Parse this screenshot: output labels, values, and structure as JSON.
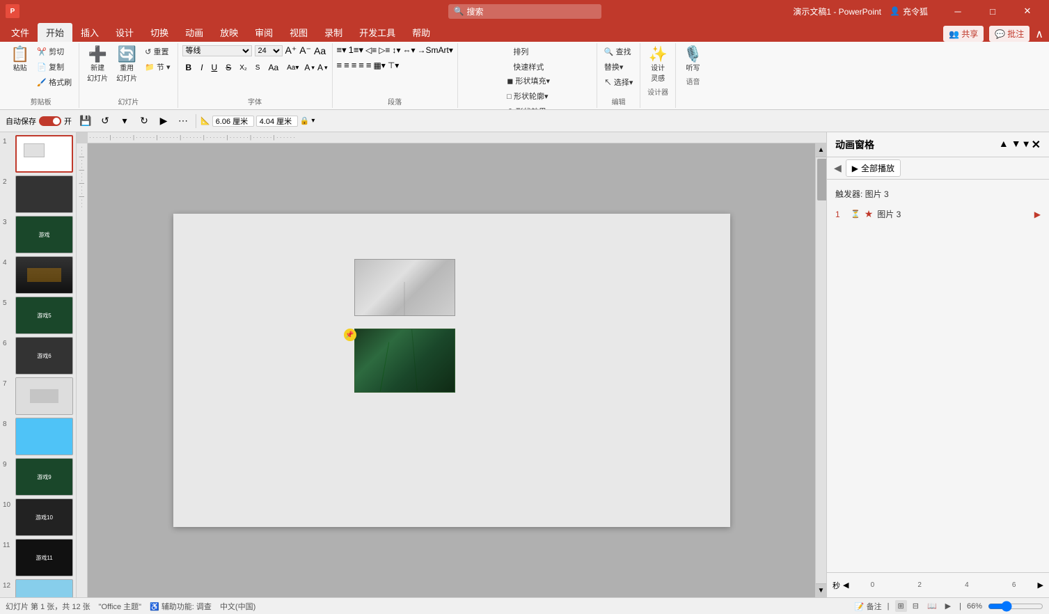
{
  "titlebar": {
    "title": "演示文稿1 - PowerPoint",
    "search_placeholder": "搜索",
    "user": "充令狐",
    "minimize": "─",
    "maximize": "□",
    "close": "✕"
  },
  "ribbon": {
    "tabs": [
      "文件",
      "开始",
      "插入",
      "设计",
      "切换",
      "动画",
      "放映",
      "审阅",
      "视图",
      "录制",
      "开发工具",
      "帮助"
    ],
    "active_tab": "开始",
    "groups": {
      "clipboard": {
        "label": "剪贴板",
        "buttons": [
          "粘贴",
          "剪切",
          "复制",
          "格式刷"
        ]
      },
      "slides": {
        "label": "幻灯片",
        "buttons": [
          "新建幻灯片",
          "重用幻灯片",
          "重置",
          "节"
        ]
      }
    },
    "share_btn": "共享",
    "comment_btn": "批注"
  },
  "quickaccess": {
    "autosave_label": "自动保存",
    "autosave_on": true,
    "tools": [
      "保存",
      "撤销",
      "重做",
      "从当前开始"
    ],
    "width_label": "6.06 厘米",
    "height_label": "4.04 厘米"
  },
  "slides": [
    {
      "num": 1,
      "active": true
    },
    {
      "num": 2,
      "active": false
    },
    {
      "num": 3,
      "active": false
    },
    {
      "num": 4,
      "active": false
    },
    {
      "num": 5,
      "active": false
    },
    {
      "num": 6,
      "active": false
    },
    {
      "num": 7,
      "active": false
    },
    {
      "num": 8,
      "active": false
    },
    {
      "num": 9,
      "active": false
    },
    {
      "num": 10,
      "active": false
    },
    {
      "num": 11,
      "active": false
    },
    {
      "num": 12,
      "active": false
    }
  ],
  "anim_panel": {
    "title": "动画窗格",
    "play_all_btn": "全部播放",
    "trigger_label": "触发器: 图片 3",
    "items": [
      {
        "num": "1",
        "icon": "★",
        "label": "图片 3"
      }
    ],
    "timeline": {
      "seconds_label": "秒",
      "markers": [
        "0",
        "2",
        "4",
        "6"
      ]
    }
  },
  "statusbar": {
    "slide_info": "幻灯片 第 1 张，共 12 张",
    "theme": "\"Office 主题\"",
    "language": "中文(中国)",
    "accessibility": "辅助功能: 调查",
    "notes_btn": "备注",
    "zoom": "66%",
    "view_icons": [
      "普通视图",
      "幻灯片浏览",
      "阅读视图",
      "幻灯片放映"
    ]
  },
  "slide_objects": {
    "img1_alt": "灰色纹理图片",
    "img2_alt": "深绿色纹理图片"
  }
}
